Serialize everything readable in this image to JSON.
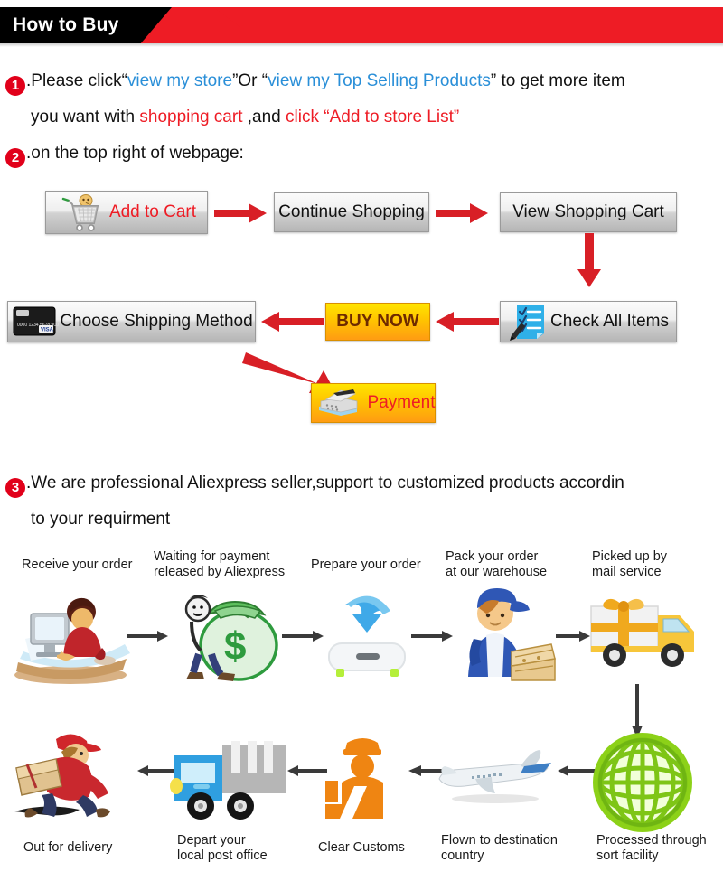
{
  "banner": {
    "title": "How to Buy",
    "black_color": "#000000",
    "red_color": "#ee1c25"
  },
  "steps": {
    "one": {
      "number": "1",
      "line1_a": ".Please click“",
      "line1_link1": "view my store",
      "line1_b": "”Or “",
      "line1_link2": "view my Top Selling Products",
      "line1_c": "” to get more item",
      "line2_a": "you want with ",
      "line2_red1": "shopping cart",
      "line2_b": " ,and ",
      "line2_red2": "click “Add to store List”"
    },
    "two": {
      "number": "2",
      "text": ".on the top right of webpage:"
    },
    "three": {
      "number": "3",
      "line1": ".We are professional Aliexpress seller,support to customized products accordin",
      "line2": "to your requirment"
    }
  },
  "flow": {
    "buttons": [
      {
        "id": "add-to-cart",
        "label": "Add to Cart",
        "icon": "shopping-cart-icon",
        "style": "grey-red-text"
      },
      {
        "id": "continue-shopping",
        "label": "Continue Shopping",
        "icon": "none",
        "style": "grey"
      },
      {
        "id": "view-shopping-cart",
        "label": "View Shopping Cart",
        "icon": "none",
        "style": "grey"
      },
      {
        "id": "check-all-items",
        "label": "Check All Items",
        "icon": "checklist-icon",
        "style": "grey"
      },
      {
        "id": "buy-now",
        "label": "BUY NOW",
        "icon": "none",
        "style": "orange"
      },
      {
        "id": "choose-shipping-method",
        "label": "Choose Shipping Method",
        "icon": "credit-card-icon",
        "style": "grey"
      },
      {
        "id": "payment",
        "label": "Payment",
        "icon": "cash-register-icon",
        "style": "orange-red-text"
      }
    ],
    "arrow_color": "#d81f26"
  },
  "shipping": {
    "arrow_color": "#3a3a3a",
    "stages_top": [
      {
        "id": "receive-your-order",
        "label": "Receive your order",
        "icon": "person-at-computer-icon"
      },
      {
        "id": "waiting-for-payment",
        "label": "Waiting for payment\nreleased by Aliexpress",
        "icon": "money-bag-icon"
      },
      {
        "id": "prepare-your-order",
        "label": "Prepare your order",
        "icon": "download-box-icon"
      },
      {
        "id": "pack-your-order",
        "label": "Pack your order\nat our warehouse",
        "icon": "worker-with-boxes-icon"
      },
      {
        "id": "picked-up-by-mail",
        "label": "Picked up by\nmail service",
        "icon": "delivery-truck-gift-icon"
      }
    ],
    "stages_bottom": [
      {
        "id": "out-for-delivery",
        "label": "Out for delivery",
        "icon": "running-courier-icon"
      },
      {
        "id": "depart-post-office",
        "label": "Depart your\nlocal post office",
        "icon": "blue-post-truck-icon"
      },
      {
        "id": "clear-customs",
        "label": "Clear Customs",
        "icon": "customs-officer-icon"
      },
      {
        "id": "flown-to-destination",
        "label": "Flown to destination\ncountry",
        "icon": "airplane-icon"
      },
      {
        "id": "processed-sort-facility",
        "label": "Processed through\nsort facility",
        "icon": "green-globe-icon"
      }
    ]
  }
}
